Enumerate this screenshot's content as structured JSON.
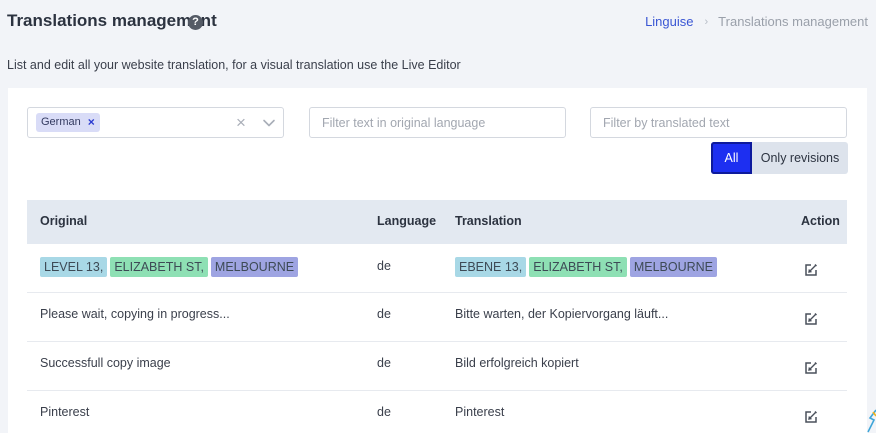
{
  "header": {
    "title": "Translations management",
    "help_icon": "?",
    "breadcrumb": [
      "Linguise",
      "Translations management"
    ],
    "breadcrumb_separator": "›"
  },
  "subtitle": "List and edit all your website translation, for a visual translation use the Live Editor",
  "filters": {
    "language_chip": "German",
    "chip_remove": "×",
    "clear_icon": "×",
    "original_placeholder": "Filter text in original language",
    "translated_placeholder": "Filter by translated text",
    "toggle_all": "All",
    "toggle_revisions": "Only revisions"
  },
  "table": {
    "columns": [
      "Original",
      "Language",
      "Translation",
      "Action"
    ],
    "rows": [
      {
        "original_tags": [
          "LEVEL 13,",
          "ELIZABETH ST,",
          "MELBOURNE"
        ],
        "language": "de",
        "translation_tags": [
          "EBENE 13,",
          "ELIZABETH ST,",
          "MELBOURNE"
        ]
      },
      {
        "original": "Please wait, copying in progress...",
        "language": "de",
        "translation": "Bitte warten, der Kopiervorgang läuft..."
      },
      {
        "original": "Successfull copy image",
        "language": "de",
        "translation": "Bild erfolgreich kopiert"
      },
      {
        "original": "Pinterest",
        "language": "de",
        "translation": "Pinterest"
      }
    ]
  },
  "colors": {
    "accent": "#1d2ff1",
    "tag_1": "#a8d8e6",
    "tag_2": "#8ee0b4",
    "tag_3": "#9ea4e2"
  }
}
